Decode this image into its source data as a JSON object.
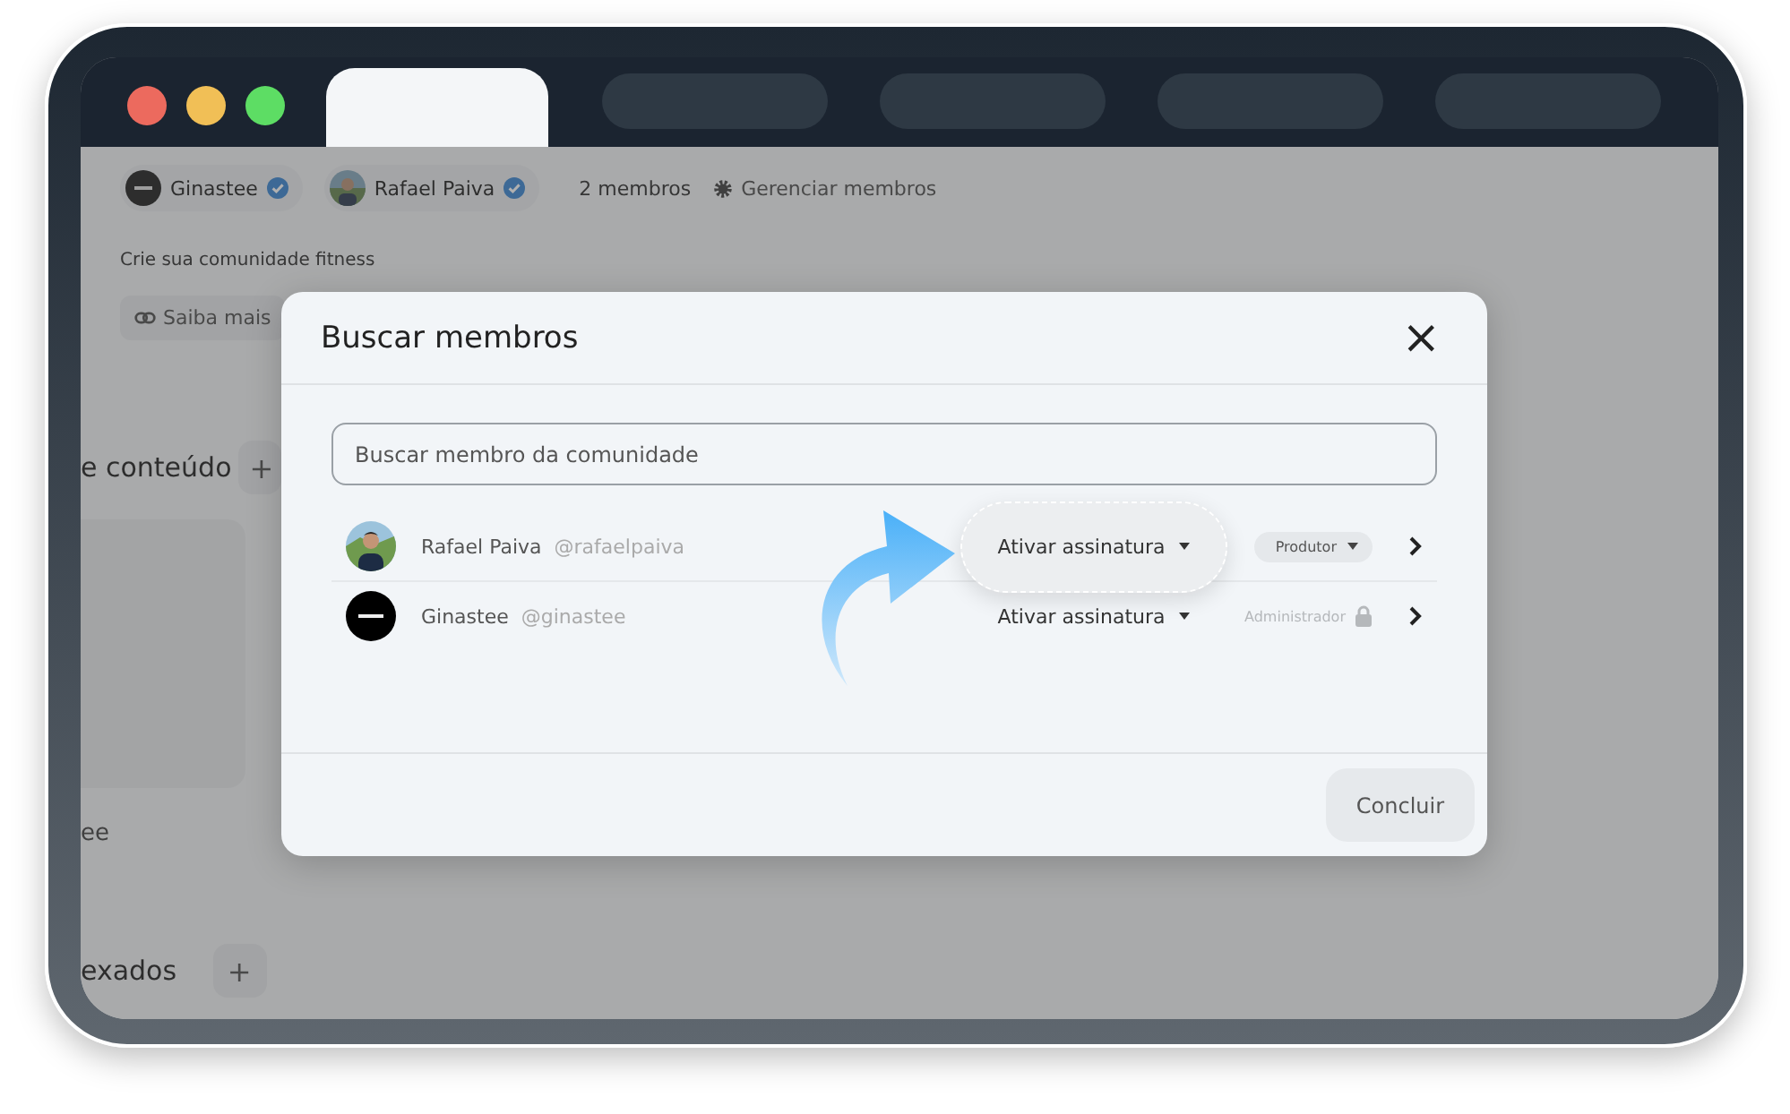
{
  "browser": {
    "tabs": [
      {
        "selected": true
      },
      {
        "selected": false
      },
      {
        "selected": false
      },
      {
        "selected": false
      },
      {
        "selected": false
      }
    ]
  },
  "page": {
    "members_chips": [
      {
        "name": "Ginastee",
        "kind": "logo"
      },
      {
        "name": "Rafael Paiva"
      }
    ],
    "member_count": "2 membros",
    "manage_link": "Gerenciar membros",
    "tagline": "Crie sua comunidade fitness",
    "learn_more": "Saiba mais",
    "section_1": "e conteúdo",
    "add_1": "+",
    "section_2": "ee",
    "section_3": "exados",
    "add_2": "+"
  },
  "modal": {
    "title": "Buscar membros",
    "close": "×",
    "search": {
      "placeholder": "Buscar membro da comunidade"
    },
    "members": [
      {
        "name": "Rafael Paiva",
        "handle": "@rafaelpaiva",
        "subscription": "Ativar assinatura",
        "highlighted": true,
        "role": "Produtor",
        "locked": false
      },
      {
        "name": "Ginastee",
        "handle": "@ginastee",
        "kind": "logo",
        "subscription": "Ativar assinatura",
        "highlighted": false,
        "role": "Administrador",
        "locked": true
      }
    ],
    "done_button": "Concluir"
  }
}
